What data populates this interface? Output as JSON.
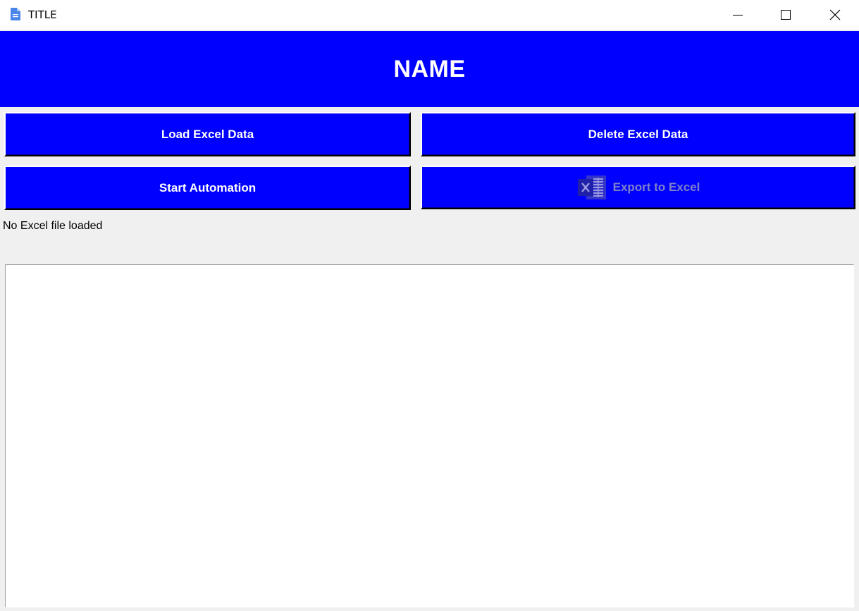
{
  "window": {
    "title": "TITLE",
    "icon": "document-icon",
    "controls": [
      "minimize-icon",
      "maximize-icon",
      "close-icon"
    ]
  },
  "header": {
    "title": "NAME",
    "background": "#0000ff",
    "text_color": "#ffffff"
  },
  "buttons": {
    "load": "Load Excel Data",
    "delete": "Delete Excel Data",
    "start": "Start Automation",
    "export": "Export to Excel"
  },
  "status": {
    "text": "No Excel file loaded"
  },
  "output": {
    "text": ""
  },
  "colors": {
    "accent": "#0000ff",
    "background": "#f0f0f0",
    "disabled_text": "#8080c8"
  }
}
